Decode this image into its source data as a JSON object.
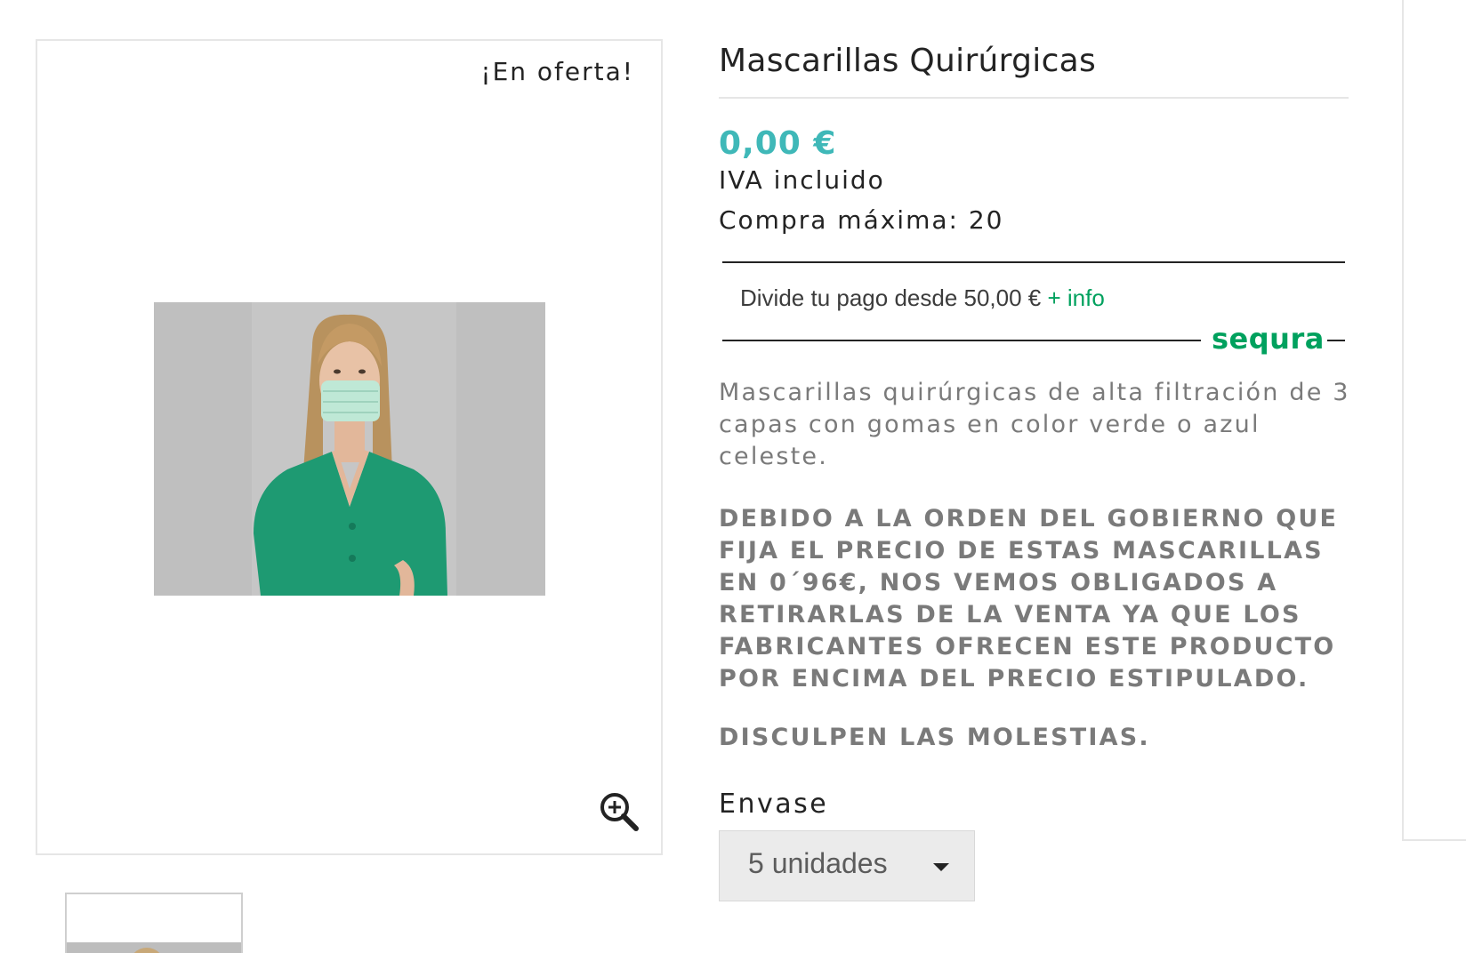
{
  "product": {
    "offer_badge": "¡En oferta!",
    "title": "Mascarillas Quirúrgicas",
    "price": "0,00 €",
    "tax_label": "IVA incluido",
    "max_purchase": "Compra máxima: 20",
    "description": "Mascarillas quirúrgicas de alta filtración de 3 capas con gomas en color verde o azul celeste.",
    "notice": "DEBIDO A LA ORDEN DEL GOBIERNO QUE FIJA EL PRECIO DE ESTAS MASCARILLAS EN 0´96€, NOS VEMOS OBLIGADOS A RETIRARLAS DE LA VENTA YA QUE LOS FABRICANTES OFRECEN ESTE PRODUCTO POR ENCIMA DEL PRECIO ESTIPULADO.",
    "apology": "DISCULPEN LAS MOLESTIAS."
  },
  "sequra": {
    "text": "Divide tu pago desde 50,00 €",
    "info_link": "+ info",
    "logo": "sequra"
  },
  "variant": {
    "label": "Envase",
    "selected": "5 unidades"
  },
  "icons": {
    "zoom": "zoom-in-icon",
    "dropdown": "caret-down-icon"
  },
  "colors": {
    "price": "#3fb8b8",
    "sequra_green": "#00a15e",
    "text_muted": "#7a7a7a"
  }
}
